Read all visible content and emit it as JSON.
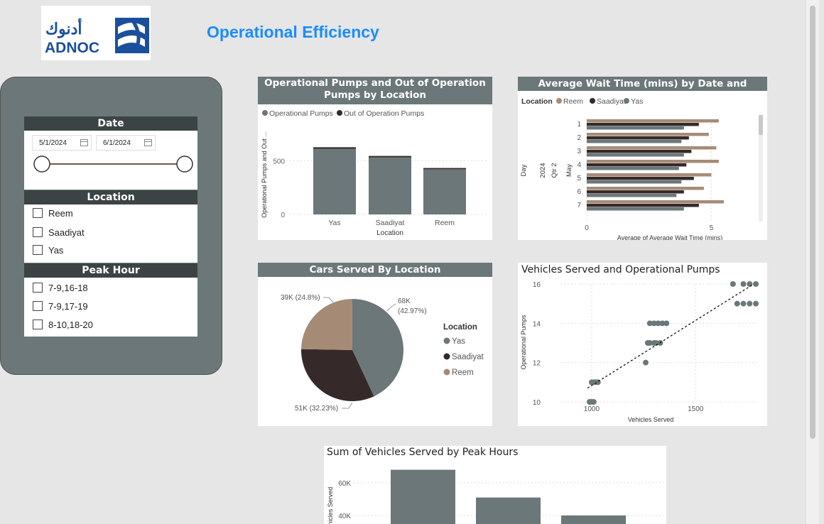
{
  "header": {
    "title": "Operational Efficiency",
    "logo_text": "ADNOC",
    "logo_arabic": "أدنوك"
  },
  "slicers": {
    "date": {
      "header": "Date",
      "start": "5/1/2024",
      "end": "6/1/2024"
    },
    "location": {
      "header": "Location",
      "items": [
        "Reem",
        "Saadiyat",
        "Yas"
      ]
    },
    "peak_hour": {
      "header": "Peak Hour",
      "items": [
        "7-9,16-18",
        "7-9,17-19",
        "8-10,18-20"
      ]
    }
  },
  "colors": {
    "yas": "#6b7779",
    "saadiyat": "#352a29",
    "reem": "#a58b76",
    "accent": "#1a8cff"
  },
  "chart_data": [
    {
      "type": "bar",
      "title": "Operational Pumps and Out of Operation Pumps by Location",
      "xlabel": "Location",
      "ylabel": "Operational Pumps and Out ...",
      "categories": [
        "Yas",
        "Saadiyat",
        "Reem"
      ],
      "series": [
        {
          "name": "Operational Pumps",
          "values": [
            610,
            530,
            420
          ]
        },
        {
          "name": "Out of Operation Pumps",
          "values": [
            15,
            14,
            12
          ]
        }
      ],
      "yticks": [
        "0",
        "500"
      ],
      "ylim": [
        0,
        700
      ],
      "legend": "top"
    },
    {
      "type": "bar",
      "title": "Average Wait Time (mins) by Date and Location",
      "legend_title": "Location",
      "xlabel": "Average of Average Wait Time (mins)",
      "ylabel": "Day",
      "hier": [
        "2024",
        "Qtr 2",
        "May"
      ],
      "categories": [
        "1",
        "2",
        "3",
        "4",
        "5",
        "6",
        "7"
      ],
      "series": [
        {
          "name": "Reem",
          "values": [
            5.3,
            4.9,
            5.2,
            5.3,
            5.0,
            4.7,
            5.5
          ]
        },
        {
          "name": "Saadiyat",
          "values": [
            4.5,
            4.1,
            4.2,
            4.0,
            4.3,
            3.9,
            4.5
          ]
        },
        {
          "name": "Yas",
          "values": [
            3.9,
            3.8,
            3.9,
            3.7,
            3.8,
            3.6,
            3.9
          ]
        }
      ],
      "xticks": [
        "0",
        "5"
      ],
      "xlim": [
        0,
        6.5
      ]
    },
    {
      "type": "pie",
      "title": "Cars Served By Location",
      "legend_title": "Location",
      "labels": [
        "Yas",
        "Saadiyat",
        "Reem"
      ],
      "values": [
        68,
        51,
        39
      ],
      "data_labels": [
        "68K (42.97%)",
        "51K (32.23%)",
        "39K (24.8%)"
      ]
    },
    {
      "type": "scatter",
      "title": "Vehicles Served and Operational Pumps",
      "xlabel": "Vehicles Served",
      "ylabel": "Operational Pumps",
      "xlim": [
        850,
        1800
      ],
      "ylim": [
        10,
        16
      ],
      "xticks": [
        "1000",
        "1500"
      ],
      "yticks": [
        "10",
        "12",
        "14",
        "16"
      ],
      "points": [
        [
          990,
          10
        ],
        [
          1000,
          10
        ],
        [
          1010,
          10
        ],
        [
          1000,
          11
        ],
        [
          1010,
          11
        ],
        [
          1020,
          11
        ],
        [
          1030,
          11
        ],
        [
          1260,
          12
        ],
        [
          1270,
          13
        ],
        [
          1280,
          13
        ],
        [
          1300,
          13
        ],
        [
          1310,
          13
        ],
        [
          1330,
          13
        ],
        [
          1280,
          14
        ],
        [
          1300,
          14
        ],
        [
          1320,
          14
        ],
        [
          1340,
          14
        ],
        [
          1360,
          14
        ],
        [
          1680,
          16
        ],
        [
          1730,
          16
        ],
        [
          1760,
          16
        ],
        [
          1790,
          16
        ],
        [
          1700,
          15
        ],
        [
          1730,
          15
        ],
        [
          1760,
          15
        ],
        [
          1790,
          15
        ]
      ],
      "trend": [
        [
          980,
          10.7
        ],
        [
          1780,
          16
        ]
      ]
    },
    {
      "type": "bar",
      "title": "Sum of Vehicles Served by Peak Hours",
      "ylabel": "Vehicles Served",
      "yticks": [
        "40K",
        "60K"
      ],
      "values": [
        68,
        51,
        40
      ],
      "ylim": [
        20,
        70
      ]
    }
  ]
}
